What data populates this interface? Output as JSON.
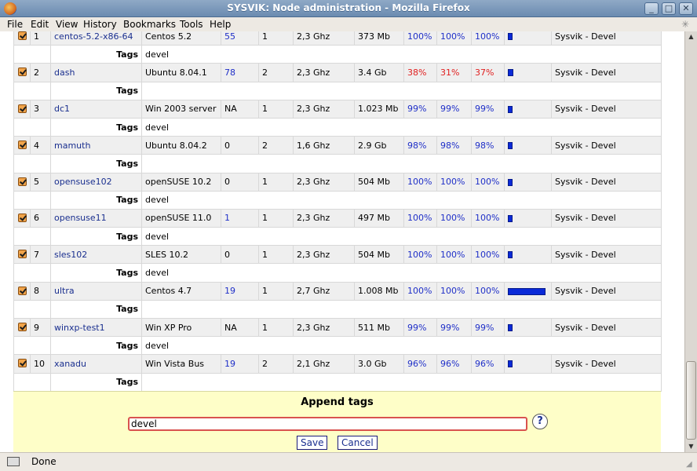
{
  "window": {
    "title": "SYSVIK: Node administration - Mozilla Firefox"
  },
  "menu": [
    "File",
    "Edit",
    "View",
    "History",
    "Bookmarks",
    "Tools",
    "Help"
  ],
  "tag_label": "Tags",
  "nodes": [
    {
      "idx": "1",
      "name": "centos-5.2-x86-64",
      "os": "Centos 5.2",
      "count": "55",
      "cpus": "1",
      "ghz": "2,3 Ghz",
      "mem": "373 Mb",
      "p1": "100%",
      "p2": "100%",
      "p3": "100%",
      "bar": 0.12,
      "group": "Sysvik - Devel",
      "tags": "devel"
    },
    {
      "idx": "2",
      "name": "dash",
      "os": "Ubuntu 8.04.1",
      "count": "78",
      "cpus": "2",
      "ghz": "2,3 Ghz",
      "mem": "3.4 Gb",
      "p1": "38%",
      "p2": "31%",
      "p3": "37%",
      "bar": 0.15,
      "group": "Sysvik - Devel",
      "tags": ""
    },
    {
      "idx": "3",
      "name": "dc1",
      "os": "Win 2003 server",
      "count": "NA",
      "cpus": "1",
      "ghz": "2,3 Ghz",
      "mem": "1.023 Mb",
      "p1": "99%",
      "p2": "99%",
      "p3": "99%",
      "bar": 0.1,
      "group": "Sysvik - Devel",
      "tags": "devel"
    },
    {
      "idx": "4",
      "name": "mamuth",
      "os": "Ubuntu 8.04.2",
      "count": "0",
      "cpus": "2",
      "ghz": "1,6 Ghz",
      "mem": "2.9 Gb",
      "p1": "98%",
      "p2": "98%",
      "p3": "98%",
      "bar": 0.1,
      "group": "Sysvik - Devel",
      "tags": ""
    },
    {
      "idx": "5",
      "name": "opensuse102",
      "os": "openSUSE 10.2",
      "count": "0",
      "cpus": "1",
      "ghz": "2,3 Ghz",
      "mem": "504 Mb",
      "p1": "100%",
      "p2": "100%",
      "p3": "100%",
      "bar": 0.1,
      "group": "Sysvik - Devel",
      "tags": "devel"
    },
    {
      "idx": "6",
      "name": "opensuse11",
      "os": "openSUSE 11.0",
      "count": "1",
      "cpus": "1",
      "ghz": "2,3 Ghz",
      "mem": "497 Mb",
      "p1": "100%",
      "p2": "100%",
      "p3": "100%",
      "bar": 0.1,
      "group": "Sysvik - Devel",
      "tags": "devel"
    },
    {
      "idx": "7",
      "name": "sles102",
      "os": "SLES 10.2",
      "count": "0",
      "cpus": "1",
      "ghz": "2,3 Ghz",
      "mem": "504 Mb",
      "p1": "100%",
      "p2": "100%",
      "p3": "100%",
      "bar": 0.1,
      "group": "Sysvik - Devel",
      "tags": "devel"
    },
    {
      "idx": "8",
      "name": "ultra",
      "os": "Centos 4.7",
      "count": "19",
      "cpus": "1",
      "ghz": "2,7 Ghz",
      "mem": "1.008 Mb",
      "p1": "100%",
      "p2": "100%",
      "p3": "100%",
      "bar": 1.0,
      "group": "Sysvik - Devel",
      "tags": ""
    },
    {
      "idx": "9",
      "name": "winxp-test1",
      "os": "Win XP Pro",
      "count": "NA",
      "cpus": "1",
      "ghz": "2,3 Ghz",
      "mem": "511 Mb",
      "p1": "99%",
      "p2": "99%",
      "p3": "99%",
      "bar": 0.1,
      "group": "Sysvik - Devel",
      "tags": "devel"
    },
    {
      "idx": "10",
      "name": "xanadu",
      "os": "Win Vista Bus",
      "count": "19",
      "cpus": "2",
      "ghz": "2,1 Ghz",
      "mem": "3.0 Gb",
      "p1": "96%",
      "p2": "96%",
      "p3": "96%",
      "bar": 0.1,
      "group": "Sysvik - Devel",
      "tags": ""
    }
  ],
  "append_tags": {
    "heading": "Append tags",
    "value": "devel",
    "help": "?",
    "save_label": "Save",
    "cancel_label": "Cancel"
  },
  "status": {
    "text": "Done"
  },
  "colors": {
    "bar": "#0a2ad8",
    "warning": "#e02020",
    "panel": "#fefec8"
  }
}
